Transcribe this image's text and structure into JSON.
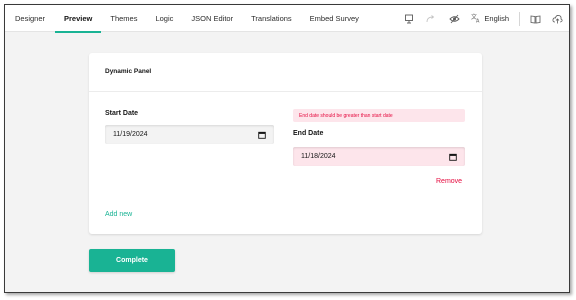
{
  "toolbar": {
    "tabs": [
      {
        "label": "Designer"
      },
      {
        "label": "Preview",
        "active": true
      },
      {
        "label": "Themes"
      },
      {
        "label": "Logic"
      },
      {
        "label": "JSON Editor"
      },
      {
        "label": "Translations"
      },
      {
        "label": "Embed Survey"
      }
    ],
    "language": "English",
    "icons": [
      "device-icon",
      "undo-icon",
      "hide-invisible-icon",
      "translate-icon",
      "book-icon",
      "cloud-upload-icon"
    ]
  },
  "panel": {
    "title": "Dynamic Panel",
    "start_date": {
      "title": "Start Date",
      "value": "11/19/2024"
    },
    "end_date": {
      "title": "End Date",
      "value": "11/18/2024",
      "error": "End date should be greater than start date"
    },
    "remove_label": "Remove",
    "add_new_label": "Add new"
  },
  "complete_label": "Complete",
  "colors": {
    "accent": "#19b394",
    "error": "#e50a3e",
    "error_bg": "#fde5eb",
    "page_bg": "#f3f3f3"
  }
}
